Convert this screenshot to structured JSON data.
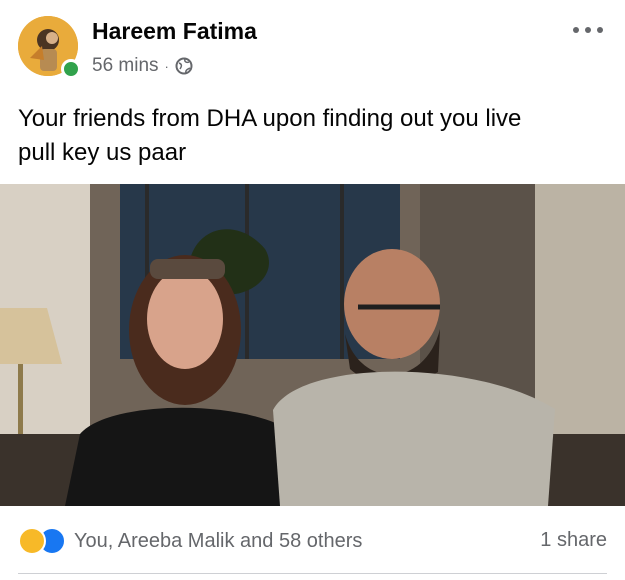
{
  "post": {
    "author": "Hareem Fatima",
    "time": "56 mins",
    "separator": "·",
    "text_line1": "Your friends from DHA upon finding out you live",
    "text_line2": "pull key us paar",
    "privacy_icon": "globe-icon",
    "more_icon": "ellipsis-icon"
  },
  "media": {
    "description_icon": "photo"
  },
  "footer": {
    "reactions": [
      "haha-icon",
      "like-icon"
    ],
    "reaction_summary": "You, Areeba Malik and 58 others",
    "shares": "1 share"
  },
  "colors": {
    "secondary_text": "#65676b",
    "online": "#31a24c",
    "like_blue": "#1877f2",
    "haha_yellow": "#f7b928"
  }
}
